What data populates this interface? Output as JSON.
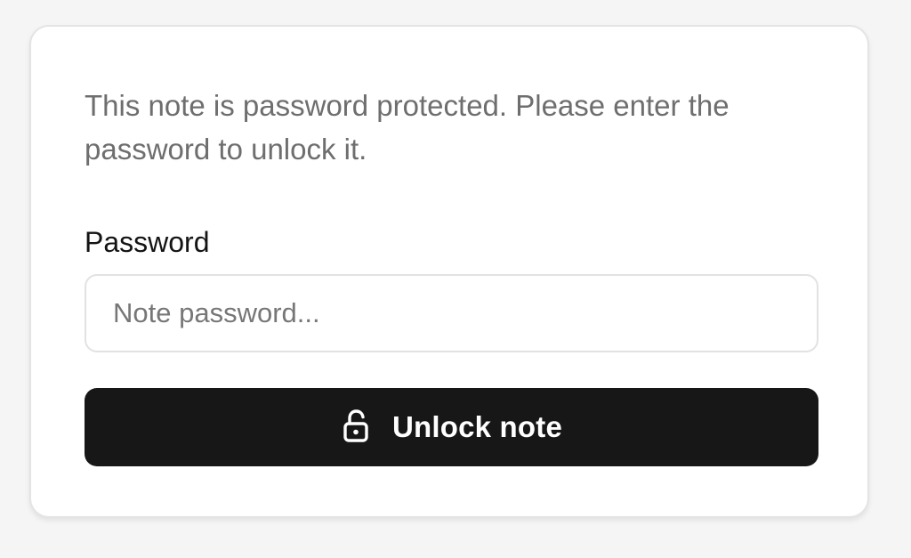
{
  "note": {
    "message": "This note is password protected. Please enter the password to unlock it.",
    "password_label": "Password",
    "password_placeholder": "Note password...",
    "password_value": "",
    "unlock_button_label": "Unlock note",
    "unlock_icon": "unlock-icon"
  },
  "colors": {
    "button_background": "#171717",
    "button_text": "#ffffff",
    "message_text": "#6e6e6e",
    "card_background": "#ffffff"
  }
}
